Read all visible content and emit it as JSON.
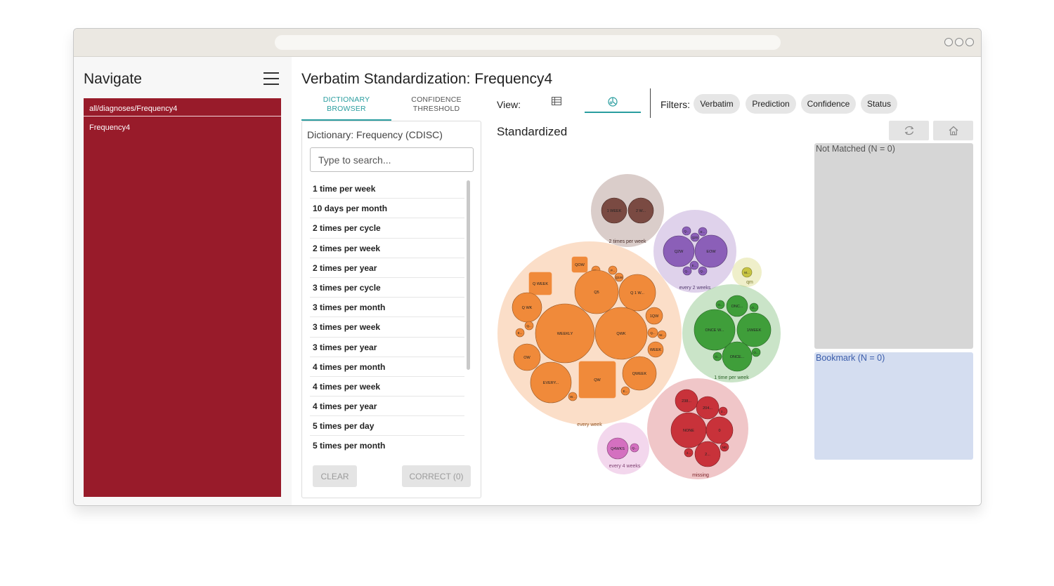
{
  "sidebar": {
    "title": "Navigate",
    "breadcrumb": "all/diagnoses/Frequency4",
    "items": [
      "Frequency4"
    ]
  },
  "page": {
    "title": "Verbatim Standardization: Frequency4"
  },
  "tabs": [
    {
      "line1": "DICTIONARY",
      "line2": "BROWSER",
      "active": true
    },
    {
      "line1": "CONFIDENCE",
      "line2": "THRESHOLD",
      "active": false
    }
  ],
  "dictionary": {
    "title": "Dictionary: Frequency (CDISC)",
    "search_placeholder": "Type to search...",
    "items": [
      "1 time per week",
      "10 days per month",
      "2 times per cycle",
      "2 times per week",
      "2 times per year",
      "3 times per cycle",
      "3 times per month",
      "3 times per week",
      "3 times per year",
      "4 times per month",
      "4 times per week",
      "4 times per year",
      "5 times per day",
      "5 times per month"
    ],
    "clear_label": "CLEAR",
    "correct_label": "CORRECT (0)"
  },
  "view": {
    "label": "View:",
    "options": [
      "table-icon",
      "bubble-chart-icon"
    ],
    "selected": "bubble-chart-icon"
  },
  "filters": {
    "label": "Filters:",
    "chips": [
      "Verbatim",
      "Prediction",
      "Confidence",
      "Status"
    ]
  },
  "standardized": {
    "title": "Standardized"
  },
  "toolbar": {
    "icons": [
      "refresh-icon",
      "home-icon"
    ]
  },
  "bins": {
    "not_matched": "Not Matched (N = 0)",
    "bookmark": "Bookmark (N = 0)"
  },
  "colors": {
    "accent": "#2a9d9f",
    "nav": "#981b2a",
    "orange": "#f08a3a",
    "brown": "#7a4a42",
    "purple": "#8b5fb8",
    "green": "#3f9e3a",
    "red": "#c8323a",
    "pink": "#d470c0",
    "olive": "#c7c442"
  },
  "chart_data": {
    "type": "bubble",
    "groups": [
      {
        "name": "every week",
        "color": "#f08a3a",
        "children": [
          "Q WEEK",
          "QOW",
          "W...",
          "P...",
          "Q1W",
          "Q5",
          "Q 1 W...",
          "Q WK",
          "Q...",
          "E...",
          "1QW",
          "WEEKLY",
          "QWK",
          "Q...",
          "W...",
          "OW",
          "WEEK",
          "EVERY...",
          "QW",
          "QWEEK",
          "W...",
          "E..."
        ]
      },
      {
        "name": "2 times per week",
        "color": "#7a4a42",
        "children": [
          "1 WEEK",
          "2 W..."
        ]
      },
      {
        "name": "every 2 weeks",
        "color": "#8b5fb8",
        "children": [
          "Q...",
          "Q2S",
          "E...",
          "Q2W",
          "EOW",
          "E...",
          "Q...",
          "Q..."
        ]
      },
      {
        "name": "qm",
        "color": "#c7c442",
        "children": [
          "M..."
        ]
      },
      {
        "name": "1 time per week",
        "color": "#3f9e3a",
        "children": [
          "O...",
          "ONC...",
          "O...",
          "ONCE W...",
          "1/WEEK",
          "O...",
          "ONCE...",
          "O..."
        ]
      },
      {
        "name": "missing",
        "color": "#c8323a",
        "children": [
          "238...",
          "204...",
          "2...",
          "NONE",
          "0",
          "2...",
          "2...",
          "ND"
        ]
      },
      {
        "name": "every 4 weeks",
        "color": "#d470c0",
        "children": [
          "Q4WKS",
          "Q..."
        ]
      }
    ]
  }
}
